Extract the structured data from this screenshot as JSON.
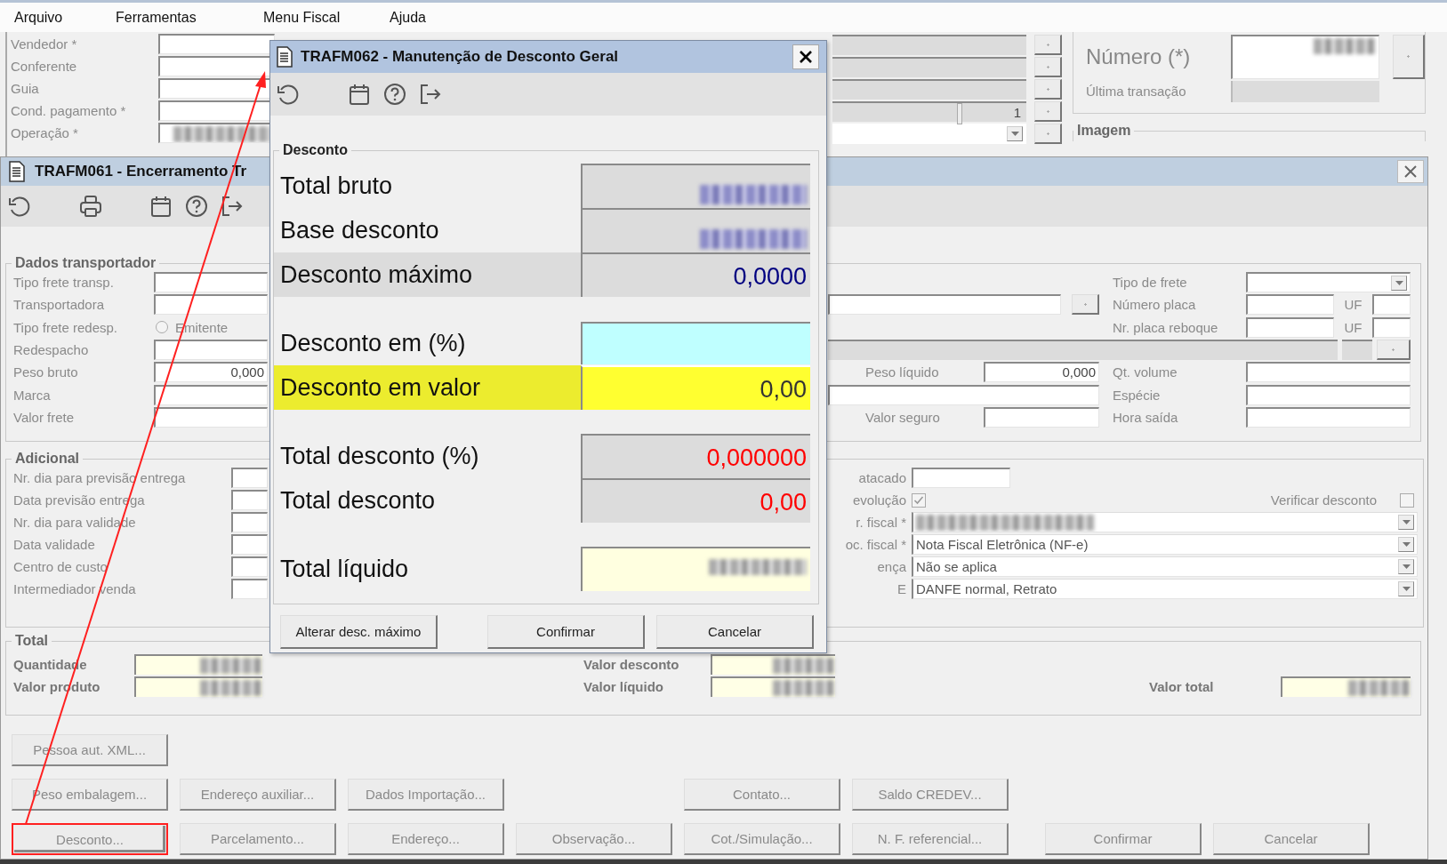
{
  "menu": [
    {
      "label": "Arquivo"
    },
    {
      "label": "Ferramentas"
    },
    {
      "label": "Menu Fiscal"
    },
    {
      "label": "Ajuda"
    }
  ],
  "back_form": {
    "rows": [
      {
        "label": "Vendedor *"
      },
      {
        "label": "Conferente"
      },
      {
        "label": "Guia"
      },
      {
        "label": "Cond. pagamento *"
      },
      {
        "label": "Operação *",
        "redacted": true
      }
    ],
    "side_fields": [
      {
        "kind": "readonly"
      },
      {
        "kind": "readonly"
      },
      {
        "kind": "readonly"
      },
      {
        "kind": "spin",
        "value": "1"
      },
      {
        "kind": "dropdown"
      }
    ],
    "number": {
      "label": "Número (*)",
      "redacted": true
    },
    "last_transaction": {
      "label": "Última transação"
    },
    "image_group": {
      "title": "Imagem"
    }
  },
  "window": {
    "title": "TRAFM061 - Encerramento Tr",
    "transport": {
      "title": "Dados transportador",
      "rows": [
        {
          "left": {
            "label": "Tipo frete transp.",
            "kind": "field"
          },
          "mid": {
            "kind": "none"
          },
          "right": {
            "label": "Tipo de frete",
            "kind": "dropdown"
          }
        },
        {
          "left": {
            "label": "Transportadora",
            "kind": "field"
          },
          "mid": {
            "kind": "lookup"
          },
          "right": {
            "label": "Número placa",
            "kind": "uf",
            "uf": "UF"
          }
        },
        {
          "left": {
            "label": "Tipo frete redesp.",
            "kind": "radio",
            "option": "Emitente",
            "selected": false
          },
          "mid": {
            "kind": "none"
          },
          "right": {
            "label": "Nr. placa reboque",
            "kind": "uf",
            "uf": "UF"
          }
        },
        {
          "left": {
            "label": "Redespacho",
            "kind": "field"
          },
          "mid": {
            "kind": "strip"
          },
          "right": {
            "kind": "strip"
          }
        },
        {
          "left": {
            "label": "Peso bruto",
            "kind": "field",
            "value": "0,000"
          },
          "mid": {
            "kind": "labeled",
            "label": "Peso líquido",
            "value": "0,000"
          },
          "right": {
            "label": "Qt. volume",
            "kind": "field"
          }
        },
        {
          "left": {
            "label": "Marca",
            "kind": "field"
          },
          "mid": {
            "kind": "field"
          },
          "right": {
            "label": "Espécie",
            "kind": "field"
          }
        },
        {
          "left": {
            "label": "Valor frete",
            "kind": "field"
          },
          "mid": {
            "kind": "labeled",
            "label": "Valor seguro"
          },
          "right": {
            "label": "Hora saída",
            "kind": "field"
          }
        }
      ]
    },
    "additional": {
      "title": "Adicional",
      "rows": [
        {
          "label": "Nr. dia para previsão entrega",
          "right_label": "atacado",
          "kind": "field"
        },
        {
          "label": "Data previsão entrega",
          "right_label": "evolução",
          "kind": "check",
          "checked": true,
          "extra_label": "Verificar desconto",
          "extra_checked": false
        },
        {
          "label": "Nr. dia para validade",
          "right_label": "r. fiscal *",
          "kind": "dropdown",
          "redacted": true
        },
        {
          "label": "Data validade",
          "right_label": "oc. fiscal *",
          "kind": "dropdown",
          "value": "Nota Fiscal Eletrônica (NF-e)"
        },
        {
          "label": "Centro de custo",
          "right_label": "ença",
          "kind": "dropdown",
          "value": "Não se aplica"
        },
        {
          "label": "Intermediador venda",
          "right_label": "E",
          "kind": "dropdown",
          "value": "DANFE normal, Retrato"
        }
      ]
    },
    "totals": {
      "title": "Total",
      "rows": [
        {
          "left": {
            "label": "Quantidade",
            "redacted": true
          },
          "mid": {
            "label": "Valor desconto",
            "redacted": true
          }
        },
        {
          "left": {
            "label": "Valor produto",
            "redacted": true
          },
          "mid": {
            "label": "Valor líquido",
            "redacted": true
          },
          "right": {
            "label": "Valor total",
            "redacted": true
          }
        }
      ]
    },
    "button_rows": [
      [
        {
          "label": "Pessoa aut. XML...",
          "highlighted": false
        }
      ],
      [
        {
          "label": "Peso embalagem...",
          "highlighted": false
        },
        {
          "label": "Endereço auxiliar...",
          "highlighted": false
        },
        {
          "label": "Dados Importação...",
          "highlighted": false
        },
        null,
        {
          "label": "Contato...",
          "highlighted": false
        },
        {
          "label": "Saldo CREDEV...",
          "highlighted": false
        }
      ],
      [
        {
          "label": "Desconto...",
          "highlighted": true
        },
        {
          "label": "Parcelamento...",
          "highlighted": false
        },
        {
          "label": "Endereço...",
          "highlighted": false
        },
        {
          "label": "Observação...",
          "highlighted": false
        },
        {
          "label": "Cot./Simulação...",
          "highlighted": false
        },
        {
          "label": "N. F. referencial...",
          "highlighted": false
        }
      ]
    ],
    "actions": [
      {
        "label": "Confirmar"
      },
      {
        "label": "Cancelar"
      }
    ]
  },
  "dialog": {
    "title": "TRAFM062 - Manutenção de Desconto Geral",
    "group": "Desconto",
    "sections": [
      [
        {
          "label": "Total bruto",
          "kind": "readonly",
          "redacted": true
        },
        {
          "label": "Base desconto",
          "kind": "readonly",
          "redacted": true
        },
        {
          "label": "Desconto máximo",
          "kind": "readonly",
          "shaded": true,
          "value": "0,0000",
          "color": "#000080"
        }
      ],
      [
        {
          "label": "Desconto em (%)",
          "kind": "input"
        },
        {
          "label": "Desconto em valor",
          "kind": "active",
          "value": "0,00"
        }
      ],
      [
        {
          "label": "Total desconto (%)",
          "kind": "readonly",
          "value": "0,000000",
          "color": "#ff0000"
        },
        {
          "label": "Total desconto",
          "kind": "readonly",
          "value": "0,00",
          "color": "#ff0000"
        }
      ],
      [
        {
          "label": "Total líquido",
          "kind": "result",
          "redacted": true
        }
      ]
    ],
    "buttons": [
      {
        "label": "Alterar desc. máximo"
      },
      {
        "label": "Confirmar"
      },
      {
        "label": "Cancelar"
      }
    ]
  }
}
